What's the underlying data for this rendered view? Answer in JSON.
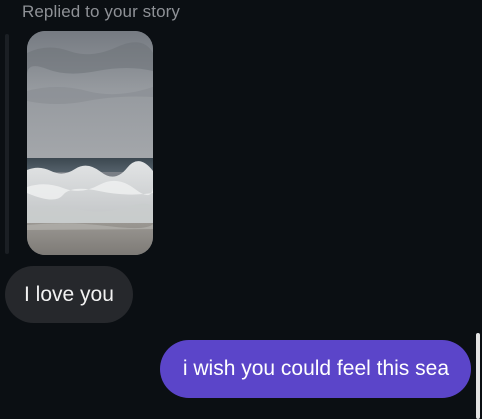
{
  "reply_header": {
    "label": "Replied to your story"
  },
  "story_preview": {
    "image_name": "sea-waves-photo",
    "colors": {
      "sky": "#8d9196",
      "sea": "#3f4a52",
      "foam": "#d7d9da",
      "sand": "#8a8682"
    }
  },
  "messages": [
    {
      "direction": "incoming",
      "text": "I love you",
      "bubble_color": "#26282c"
    },
    {
      "direction": "outgoing",
      "text": "i wish you could feel this sea",
      "bubble_color": "#5b45c9"
    }
  ],
  "theme": {
    "background": "#0b0f13",
    "muted_text": "#8e9196"
  }
}
